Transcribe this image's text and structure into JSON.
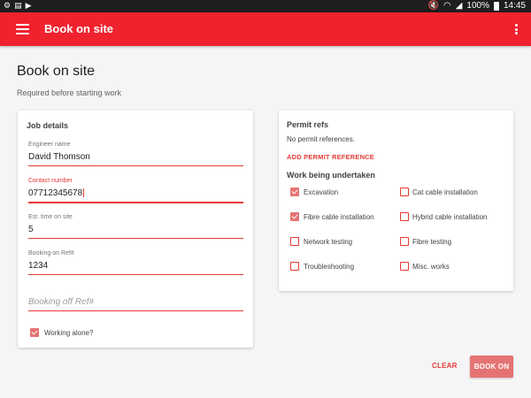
{
  "status_bar": {
    "left_icons": [
      "settings-icon",
      "file-icon",
      "play-icon"
    ],
    "battery": "100%",
    "time": "14:45"
  },
  "app_bar": {
    "title": "Book on site",
    "color": "#f0222e"
  },
  "page": {
    "title": "Book on site",
    "subtitle": "Required before starting work"
  },
  "job_details": {
    "heading": "Job details",
    "fields": [
      {
        "label": "Engineer name",
        "value": "David Thomson"
      },
      {
        "label": "Contact number",
        "value": "07712345678"
      },
      {
        "label": "Est. time on site",
        "value": "5"
      },
      {
        "label": "Booking on Ref#",
        "value": "1234"
      },
      {
        "label": "",
        "placeholder": "Booking off Ref#"
      }
    ],
    "working_alone": {
      "label": "Working alone?",
      "checked": true
    }
  },
  "permit_refs": {
    "heading": "Permit refs",
    "empty_text": "No permit references.",
    "add_label": "ADD PERMIT REFERENCE"
  },
  "work_undertaken": {
    "heading": "Work being undertaken",
    "items": [
      {
        "label": "Excavation",
        "checked": true
      },
      {
        "label": "Cat cable installation",
        "checked": false
      },
      {
        "label": "Fibre cable installation",
        "checked": true
      },
      {
        "label": "Hybrid cable installation",
        "checked": false
      },
      {
        "label": "Network testing",
        "checked": false
      },
      {
        "label": "Fibre testing",
        "checked": false
      },
      {
        "label": "Troubleshooting",
        "checked": false
      },
      {
        "label": "Misc. works",
        "checked": false
      }
    ]
  },
  "actions": {
    "clear_label": "CLEAR",
    "book_on_label": "BOOK ON"
  }
}
